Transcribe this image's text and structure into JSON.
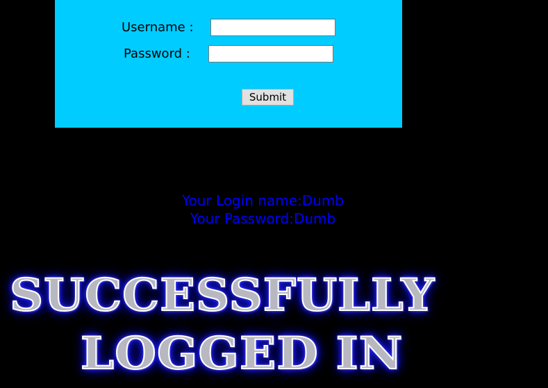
{
  "login_form": {
    "username_label": "Username :",
    "password_label": "Password :",
    "username_value": "",
    "password_value": "",
    "submit_label": "Submit",
    "panel_color": "#00CCFF"
  },
  "result": {
    "login_name_line": "Your Login name:Dumb",
    "password_line": "Your Password:Dumb",
    "text_color": "#0000FF"
  },
  "banner": {
    "line1": "SUCCESSFULLY",
    "line2": "LOGGED IN",
    "glow_color": "#1a1aff"
  }
}
